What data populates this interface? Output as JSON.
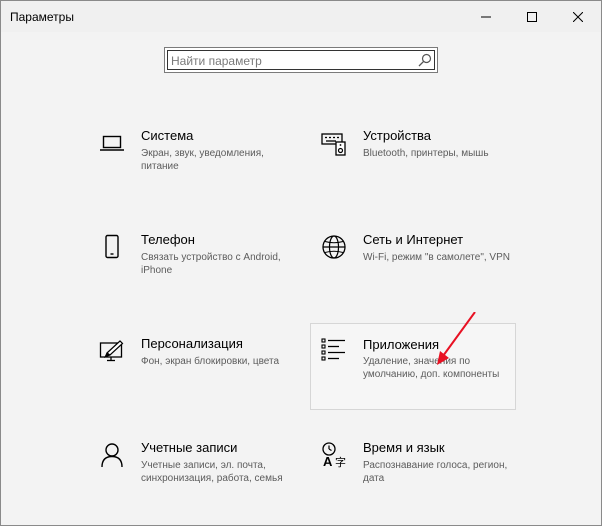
{
  "window": {
    "title": "Параметры",
    "controls": {
      "minimize": "minimize",
      "maximize": "maximize",
      "close": "close"
    }
  },
  "search": {
    "placeholder": "Найти параметр",
    "value": ""
  },
  "categories": [
    {
      "name": "Система",
      "description": "Экран, звук, уведомления, питание",
      "icon": "laptop-icon"
    },
    {
      "name": "Устройства",
      "description": "Bluetooth, принтеры, мышь",
      "icon": "devices-icon"
    },
    {
      "name": "Телефон",
      "description": "Связать устройство с Android, iPhone",
      "icon": "phone-icon"
    },
    {
      "name": "Сеть и Интернет",
      "description": "Wi-Fi, режим \"в самолете\", VPN",
      "icon": "globe-icon"
    },
    {
      "name": "Персонализация",
      "description": "Фон, экран блокировки, цвета",
      "icon": "personalization-icon"
    },
    {
      "name": "Приложения",
      "description": "Удаление, значения по умолчанию, доп. компоненты",
      "icon": "apps-list-icon",
      "highlighted": true
    },
    {
      "name": "Учетные записи",
      "description": "Учетные записи, эл. почта, синхронизация, работа, семья",
      "icon": "person-icon"
    },
    {
      "name": "Время и язык",
      "description": "Распознавание голоса, регион, дата",
      "icon": "time-language-icon"
    }
  ],
  "annotation": {
    "arrow_color": "#e81123"
  }
}
